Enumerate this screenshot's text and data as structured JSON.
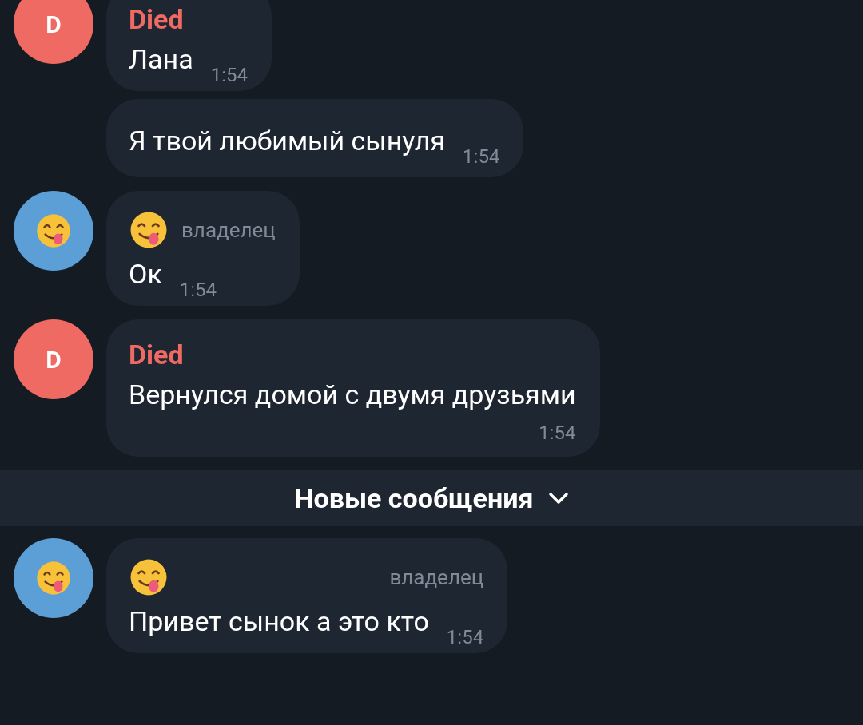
{
  "messages": [
    {
      "kind": "message",
      "avatar": {
        "kind": "letter",
        "text": "D",
        "color": "#ee6a63"
      },
      "sender": {
        "name": "Died",
        "color": "#ee6a63"
      },
      "text": "Лана",
      "time": "1:54",
      "time_below": false
    },
    {
      "kind": "message",
      "text": "Я твой любимый сынуля",
      "time": "1:54",
      "time_below": false
    },
    {
      "kind": "message",
      "avatar": {
        "kind": "emoji",
        "color": "#5b9fd6"
      },
      "sender": {
        "kind": "emoji"
      },
      "badge": "владелец",
      "text": "Ок",
      "time": "1:54",
      "time_below": false
    },
    {
      "kind": "message",
      "avatar": {
        "kind": "letter",
        "text": "D",
        "color": "#ee6a63"
      },
      "sender": {
        "name": "Died",
        "color": "#ee6a63"
      },
      "text": "Вернулся домой с двумя друзьями",
      "time": "1:54",
      "time_below": true
    },
    {
      "kind": "divider",
      "label": "Новые сообщения"
    },
    {
      "kind": "message",
      "avatar": {
        "kind": "emoji",
        "color": "#5b9fd6"
      },
      "sender": {
        "kind": "emoji"
      },
      "badge": "владелец",
      "text": "Привет сынок а это кто",
      "time": "1:54",
      "time_below": false
    }
  ]
}
